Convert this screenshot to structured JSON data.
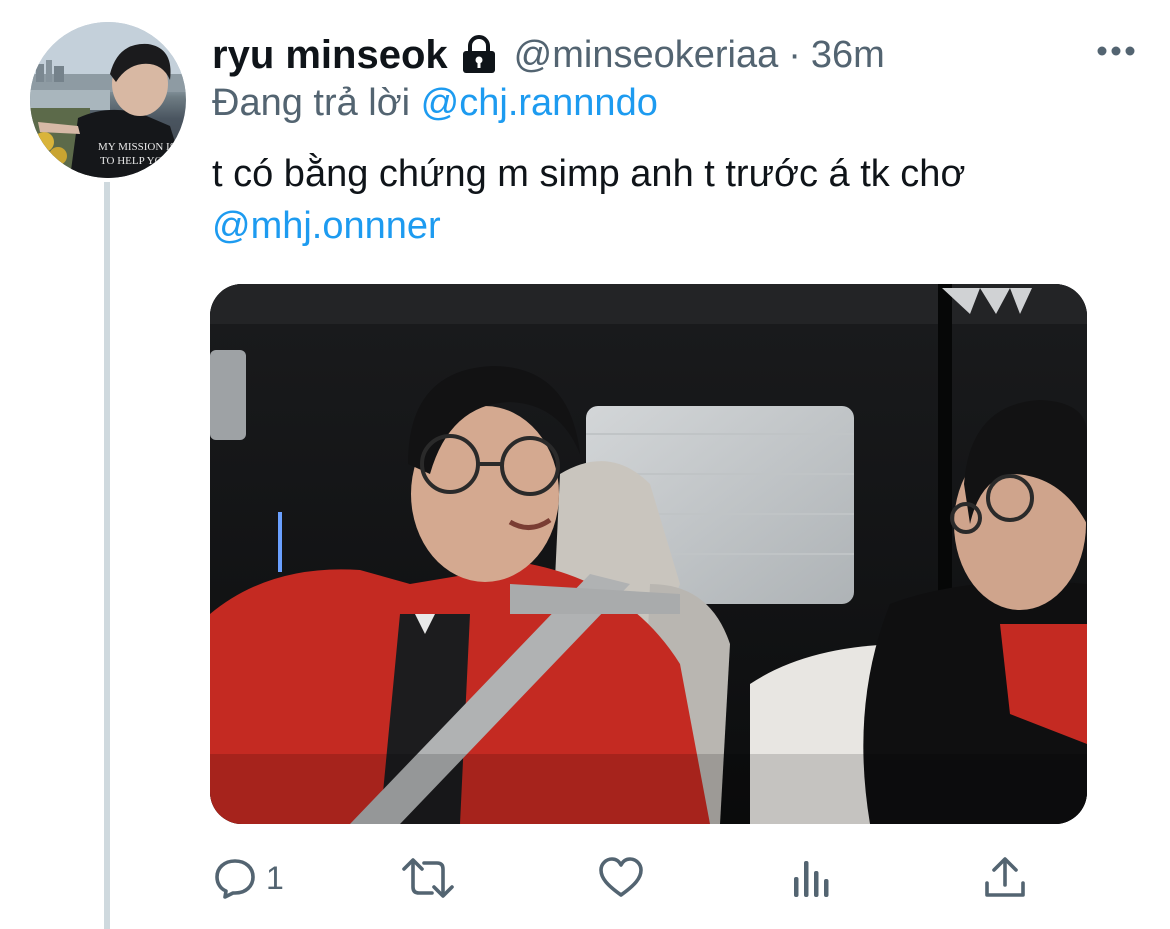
{
  "tweet": {
    "display_name": "ryu minseok",
    "handle": "@minseokeriaa",
    "separator": "·",
    "time": "36m",
    "reply_prefix": "Đang trả lời",
    "reply_to": "@chj.rannndo",
    "text": "t có bằng chứng m simp anh t trước á tk chơ",
    "text_mention": "@mhj.onnner",
    "reply_count": "1"
  },
  "colors": {
    "link": "#1d9bf0",
    "secondary_text": "#536471",
    "primary_text": "#0f1419",
    "thread_line": "#cfd9de"
  },
  "icons": {
    "lock": "lock-icon",
    "more": "more-horizontal-icon",
    "reply": "reply-bubble-icon",
    "retweet": "retweet-icon",
    "like": "heart-icon",
    "analytics": "analytics-bars-icon",
    "share": "share-upload-icon"
  }
}
